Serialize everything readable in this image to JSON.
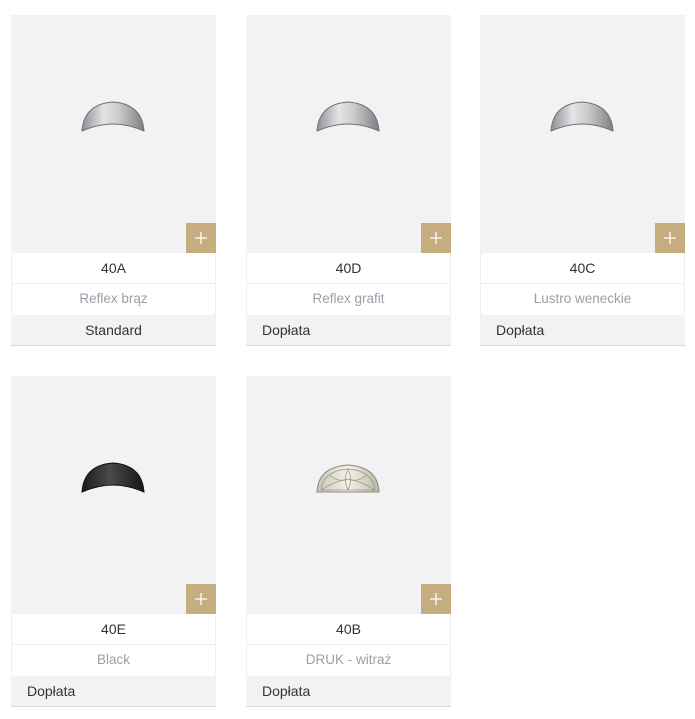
{
  "colors": {
    "card_bg": "#f1f2f4",
    "accent": "#c5ad80",
    "name_text": "#9a9ea8",
    "text": "#333333"
  },
  "cards": [
    {
      "code": "40A",
      "name": "Reflex brąz",
      "price_label": "Standard",
      "icon": "glass-silver-icon"
    },
    {
      "code": "40D",
      "name": "Reflex grafit",
      "price_label": "Dopłata",
      "icon": "glass-silver-icon"
    },
    {
      "code": "40C",
      "name": "Lustro weneckie",
      "price_label": "Dopłata",
      "icon": "glass-silver-icon"
    },
    {
      "code": "40E",
      "name": "Black",
      "price_label": "Dopłata",
      "icon": "glass-black-icon"
    },
    {
      "code": "40B",
      "name": "DRUK - witraż",
      "price_label": "Dopłata",
      "icon": "glass-stained-icon"
    }
  ]
}
